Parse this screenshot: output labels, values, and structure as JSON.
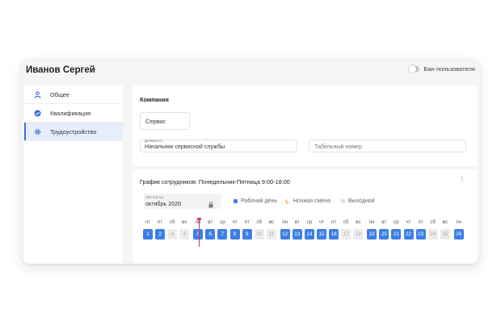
{
  "header": {
    "user_name": "Иванов Сергей",
    "ban_label": "Бан пользователя"
  },
  "sidebar": {
    "items": [
      {
        "label": "Общее",
        "icon": "person-icon",
        "active": false
      },
      {
        "label": "Квалификация",
        "icon": "check-badge-icon",
        "active": false
      },
      {
        "label": "Трудоустройство",
        "icon": "gear-icon",
        "active": true
      }
    ]
  },
  "company": {
    "title": "Компания",
    "service_value": "Сервис",
    "position_label": "Должность",
    "position_value": "Начальник сервисной службы",
    "tab_number_placeholder": "Табельный номер"
  },
  "schedule": {
    "title": "График сотрудников: Понедельник-Пятница 9:00-18:00",
    "month_label": "Месяц/год",
    "month_value": "октябрь 2020",
    "legend": [
      {
        "label": "Рабочий день",
        "color": "#3d7fe6"
      },
      {
        "label": "Ночная смена",
        "color": "#f2b72a"
      },
      {
        "label": "Выходной",
        "color": "#dddddd"
      }
    ],
    "today": "5",
    "days": [
      {
        "dow": "чт",
        "day": "1",
        "type": "work"
      },
      {
        "dow": "пт",
        "day": "2",
        "type": "work"
      },
      {
        "dow": "сб",
        "day": "3",
        "type": "off"
      },
      {
        "dow": "вс",
        "day": "4",
        "type": "off"
      },
      {
        "dow": "пн",
        "day": "5",
        "type": "work"
      },
      {
        "dow": "вт",
        "day": "6",
        "type": "work"
      },
      {
        "dow": "ср",
        "day": "7",
        "type": "work"
      },
      {
        "dow": "чт",
        "day": "8",
        "type": "work"
      },
      {
        "dow": "пт",
        "day": "9",
        "type": "work"
      },
      {
        "dow": "сб",
        "day": "10",
        "type": "off"
      },
      {
        "dow": "вс",
        "day": "11",
        "type": "off"
      },
      {
        "dow": "пн",
        "day": "12",
        "type": "work"
      },
      {
        "dow": "вт",
        "day": "13",
        "type": "work"
      },
      {
        "dow": "ср",
        "day": "14",
        "type": "work"
      },
      {
        "dow": "чт",
        "day": "15",
        "type": "work"
      },
      {
        "dow": "пт",
        "day": "16",
        "type": "work"
      },
      {
        "dow": "сб",
        "day": "17",
        "type": "off"
      },
      {
        "dow": "вс",
        "day": "18",
        "type": "off"
      },
      {
        "dow": "пн",
        "day": "19",
        "type": "work"
      },
      {
        "dow": "вт",
        "day": "20",
        "type": "work"
      },
      {
        "dow": "ср",
        "day": "21",
        "type": "work"
      },
      {
        "dow": "чт",
        "day": "22",
        "type": "work"
      },
      {
        "dow": "пт",
        "day": "23",
        "type": "work"
      },
      {
        "dow": "сб",
        "day": "24",
        "type": "off"
      },
      {
        "dow": "вс",
        "day": "25",
        "type": "off"
      },
      {
        "dow": "пн",
        "day": "26",
        "type": "work"
      }
    ]
  }
}
